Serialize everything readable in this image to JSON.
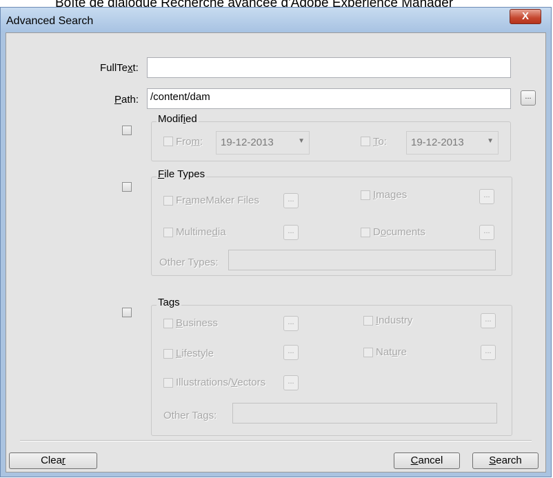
{
  "caption": "Boîte de dialogue Recherche avancée d'Adobe Experience Manager",
  "window": {
    "title": "Advanced Search",
    "close_glyph": "X"
  },
  "fulltext": {
    "label_pre": "FullTe",
    "label_u": "x",
    "label_post": "t:",
    "value": ""
  },
  "path": {
    "label_u": "P",
    "label_post": "ath:",
    "value": "/content/dam",
    "browse": "..."
  },
  "modified": {
    "group_label_pre": "Modif",
    "group_label_u": "i",
    "group_label_post": "ed",
    "from_pre": "Fro",
    "from_u": "m",
    "from_post": ":",
    "from_value": "19-12-2013",
    "to_u": "T",
    "to_post": "o:",
    "to_value": "19-12-2013"
  },
  "file_types": {
    "group_label_u": "F",
    "group_label_post": "ile Types",
    "framemaker_pre": "Fr",
    "framemaker_u": "a",
    "framemaker_post": "meMaker Files",
    "images_u": "I",
    "images_post": "mages",
    "multimedia_pre": "Multime",
    "multimedia_u": "d",
    "multimedia_post": "ia",
    "documents_pre": "D",
    "documents_u": "o",
    "documents_post": "cuments",
    "other_label": "Other Types:",
    "dots": "..."
  },
  "tags": {
    "group_label": "Tags",
    "business_u": "B",
    "business_post": "usiness",
    "industry_u": "I",
    "industry_post": "ndustry",
    "lifestyle_u": "L",
    "lifestyle_post": "ifestyle",
    "nature_pre": "Nat",
    "nature_u": "u",
    "nature_post": "re",
    "illustrations_pre": "Illustrations/",
    "illustrations_u": "V",
    "illustrations_post": "ectors",
    "other_label": "Other Tags:",
    "dots": "..."
  },
  "buttons": {
    "clear_pre": "Clea",
    "clear_u": "r",
    "cancel_u": "C",
    "cancel_post": "ancel",
    "search_u": "S",
    "search_post": "earch"
  }
}
